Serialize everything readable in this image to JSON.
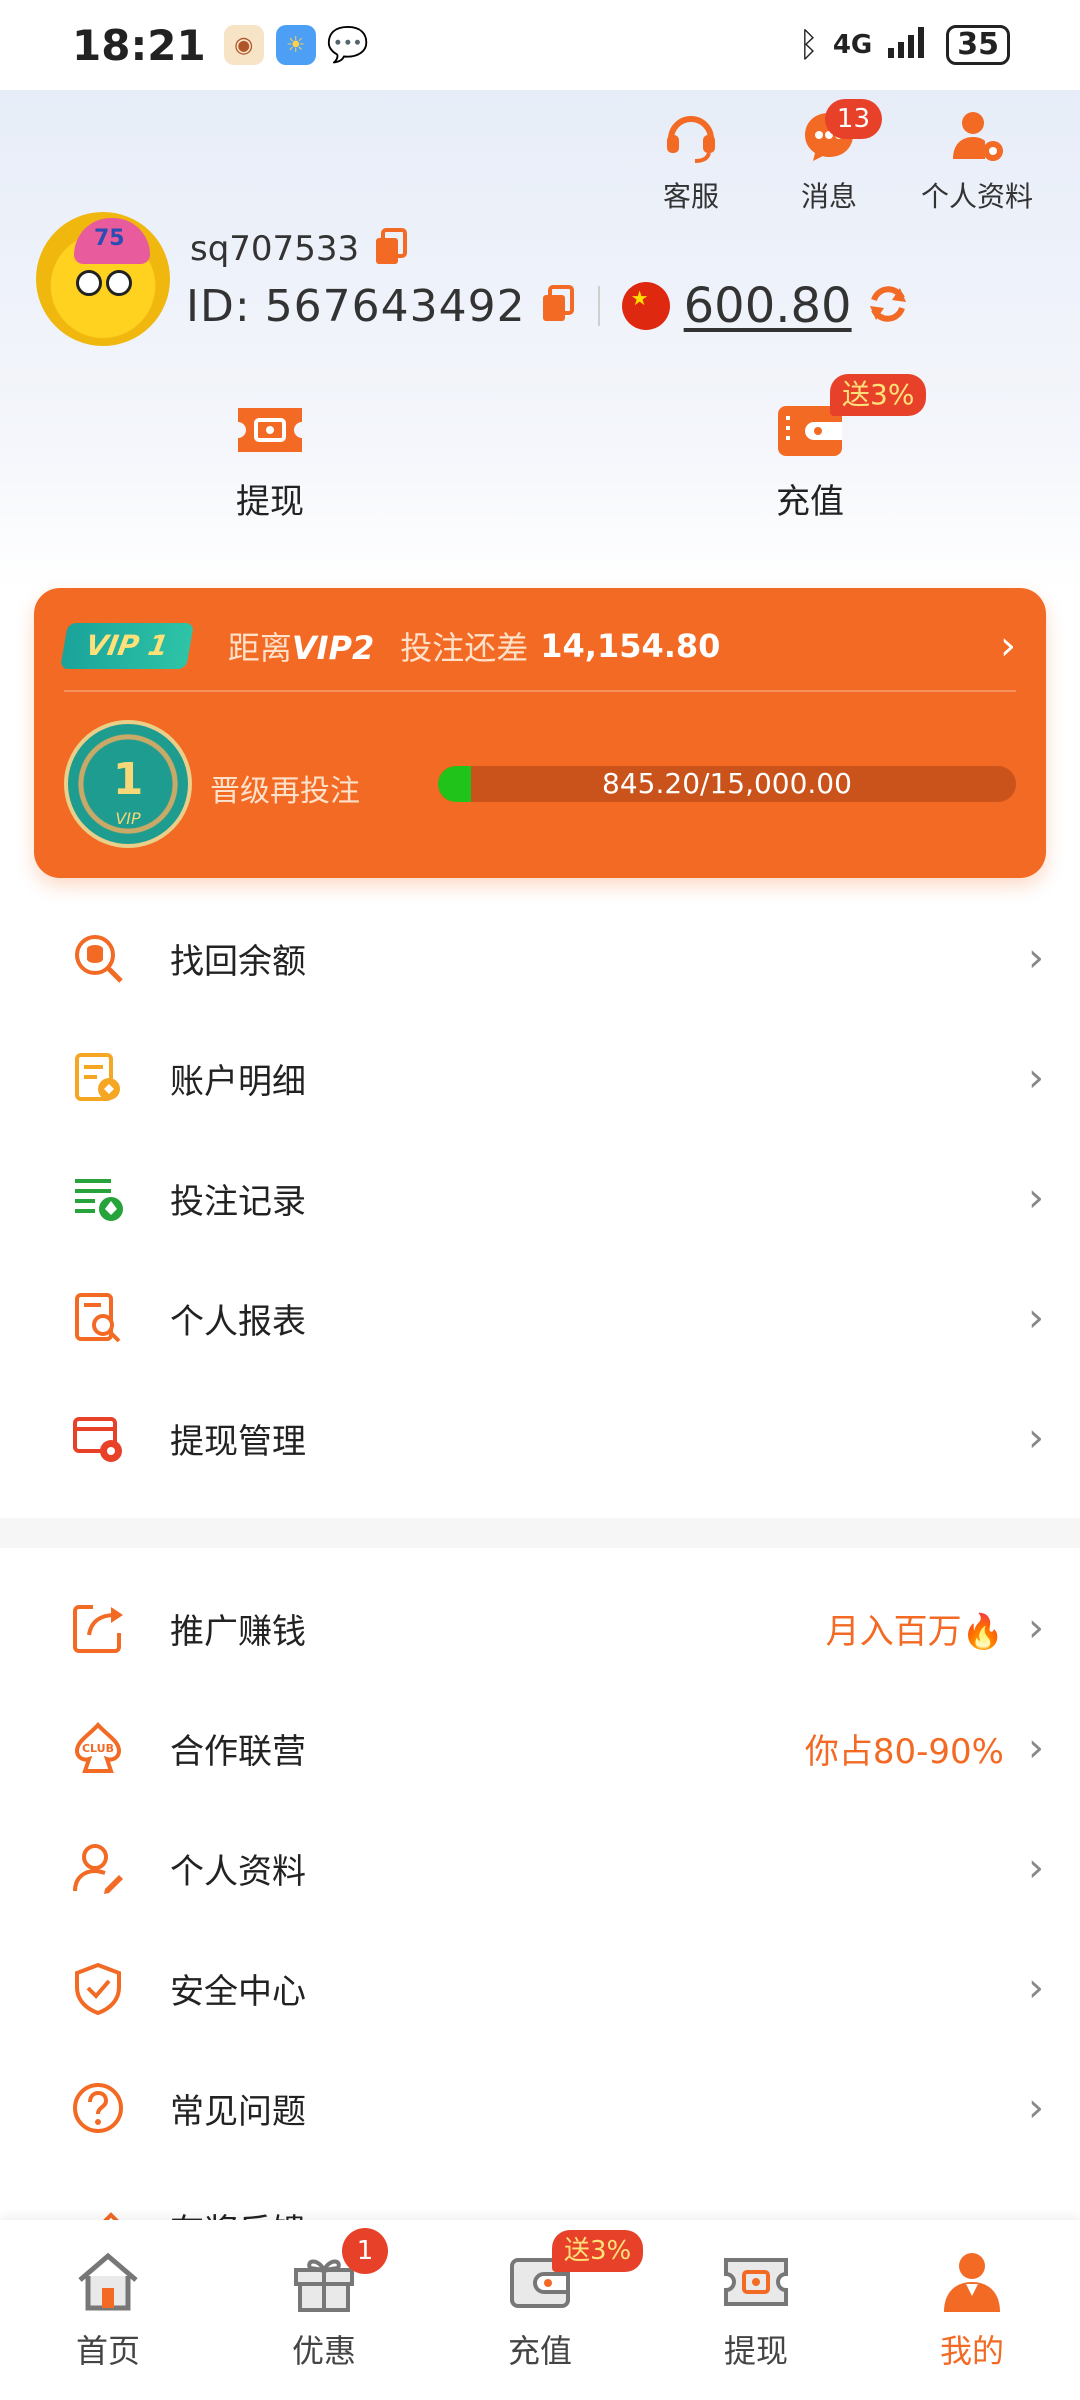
{
  "status_bar": {
    "time": "18:21",
    "network": "4G",
    "battery": "35"
  },
  "header": {
    "customer_service": "客服",
    "messages": "消息",
    "messages_badge": "13",
    "profile": "个人资料"
  },
  "user": {
    "username": "sq707533",
    "id_label": "ID:",
    "id_value": "567643492",
    "balance": "600.80"
  },
  "quick_actions": {
    "withdraw": "提现",
    "deposit": "充值",
    "deposit_badge": "送3%"
  },
  "vip": {
    "current_tag": "VIP 1",
    "distance_label": "距离",
    "next_level": "VIP2",
    "bet_gap_label": "投注还差",
    "bet_gap_amount": "14,154.80",
    "medal_level": "1",
    "medal_label": "VIP",
    "upgrade_label": "晋级再投注",
    "progress_text": "845.20/15,000.00",
    "progress_fraction": 0.0563
  },
  "menu_group_1": [
    {
      "label": "找回余额"
    },
    {
      "label": "账户明细"
    },
    {
      "label": "投注记录"
    },
    {
      "label": "个人报表"
    },
    {
      "label": "提现管理"
    }
  ],
  "menu_group_2": [
    {
      "label": "推广赚钱",
      "extra": "月入百万🔥"
    },
    {
      "label": "合作联营",
      "extra": "你占80-90%"
    },
    {
      "label": "个人资料",
      "extra": ""
    },
    {
      "label": "安全中心",
      "extra": ""
    },
    {
      "label": "常见问题",
      "extra": ""
    },
    {
      "label": "有奖反馈",
      "extra": ""
    }
  ],
  "bottom_nav": {
    "home": "首页",
    "promos": "优惠",
    "promos_badge": "1",
    "deposit": "充值",
    "deposit_badge": "送3%",
    "withdraw": "提现",
    "mine": "我的"
  },
  "colors": {
    "accent": "#f26a24",
    "badge": "#e8412a",
    "progress": "#1fc31a"
  }
}
